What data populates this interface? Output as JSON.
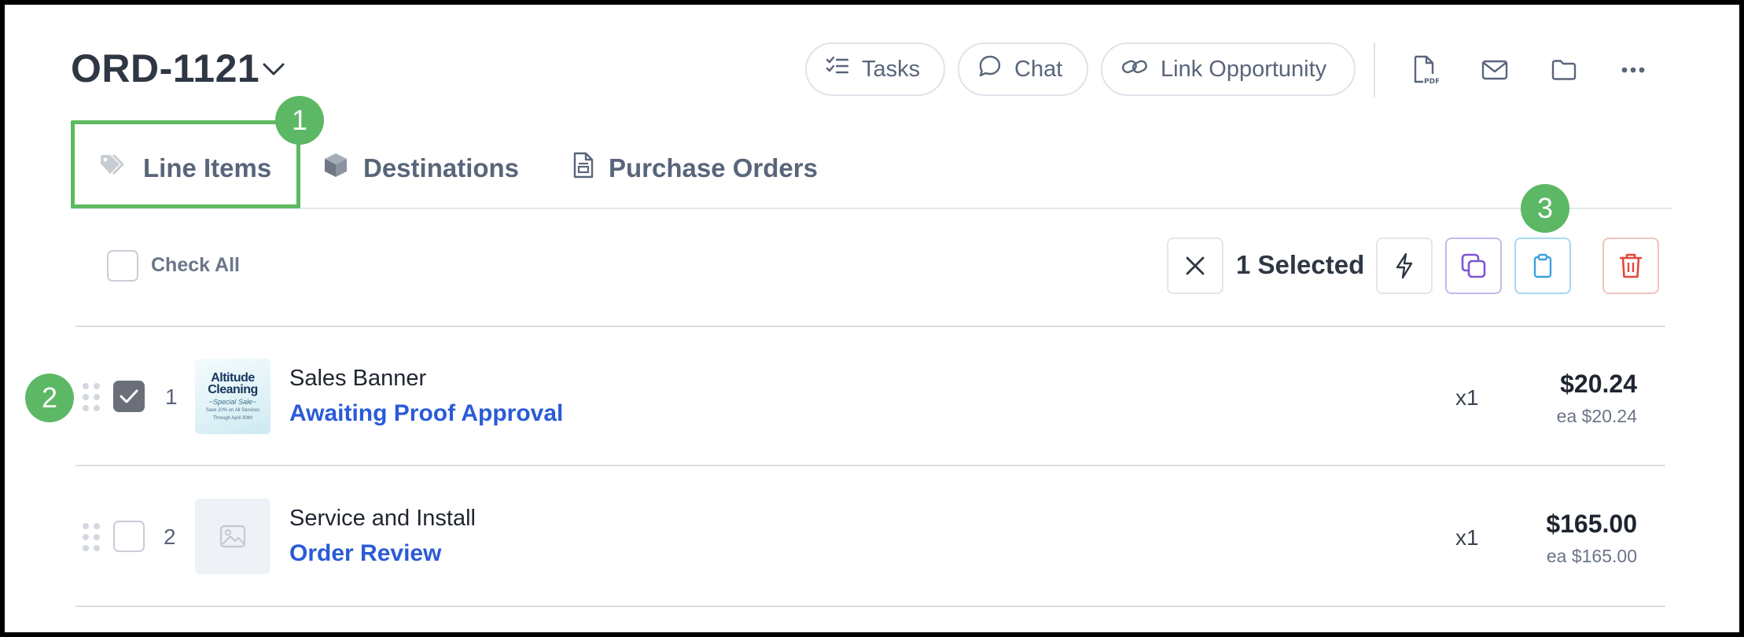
{
  "header": {
    "order_id": "ORD-1121",
    "actions": {
      "tasks": "Tasks",
      "chat": "Chat",
      "link_opportunity": "Link Opportunity"
    },
    "icons": [
      "pdf-icon",
      "mail-icon",
      "folder-icon",
      "more-icon"
    ]
  },
  "tabs": [
    {
      "label": "Line Items",
      "icon": "tag-icon",
      "active": true
    },
    {
      "label": "Destinations",
      "icon": "box-icon",
      "active": false
    },
    {
      "label": "Purchase Orders",
      "icon": "document-icon",
      "active": false
    }
  ],
  "annotations": {
    "one": "1",
    "two": "2",
    "three": "3"
  },
  "toolbar": {
    "check_all_label": "Check All",
    "selected_label": "1 Selected"
  },
  "line_items": [
    {
      "number": "1",
      "name": "Sales Banner",
      "status": "Awaiting Proof Approval",
      "quantity": "x1",
      "price": "$20.24",
      "unit_price": "ea $20.24",
      "checked": true,
      "thumbnail": {
        "line1": "Altitude",
        "line2": "Cleaning",
        "line3": "~Special Sale~",
        "line4": "Save 20% on All Services",
        "line5": "Through April 30th!"
      }
    },
    {
      "number": "2",
      "name": "Service and Install",
      "status": "Order Review",
      "quantity": "x1",
      "price": "$165.00",
      "unit_price": "ea $165.00",
      "checked": false
    }
  ],
  "colors": {
    "accent_green": "#5cb864",
    "status_blue": "#2a5bd7",
    "delete_red": "#e0493e",
    "duplicate_purple": "#7d55d6",
    "clipboard_blue": "#3aa0e0"
  }
}
